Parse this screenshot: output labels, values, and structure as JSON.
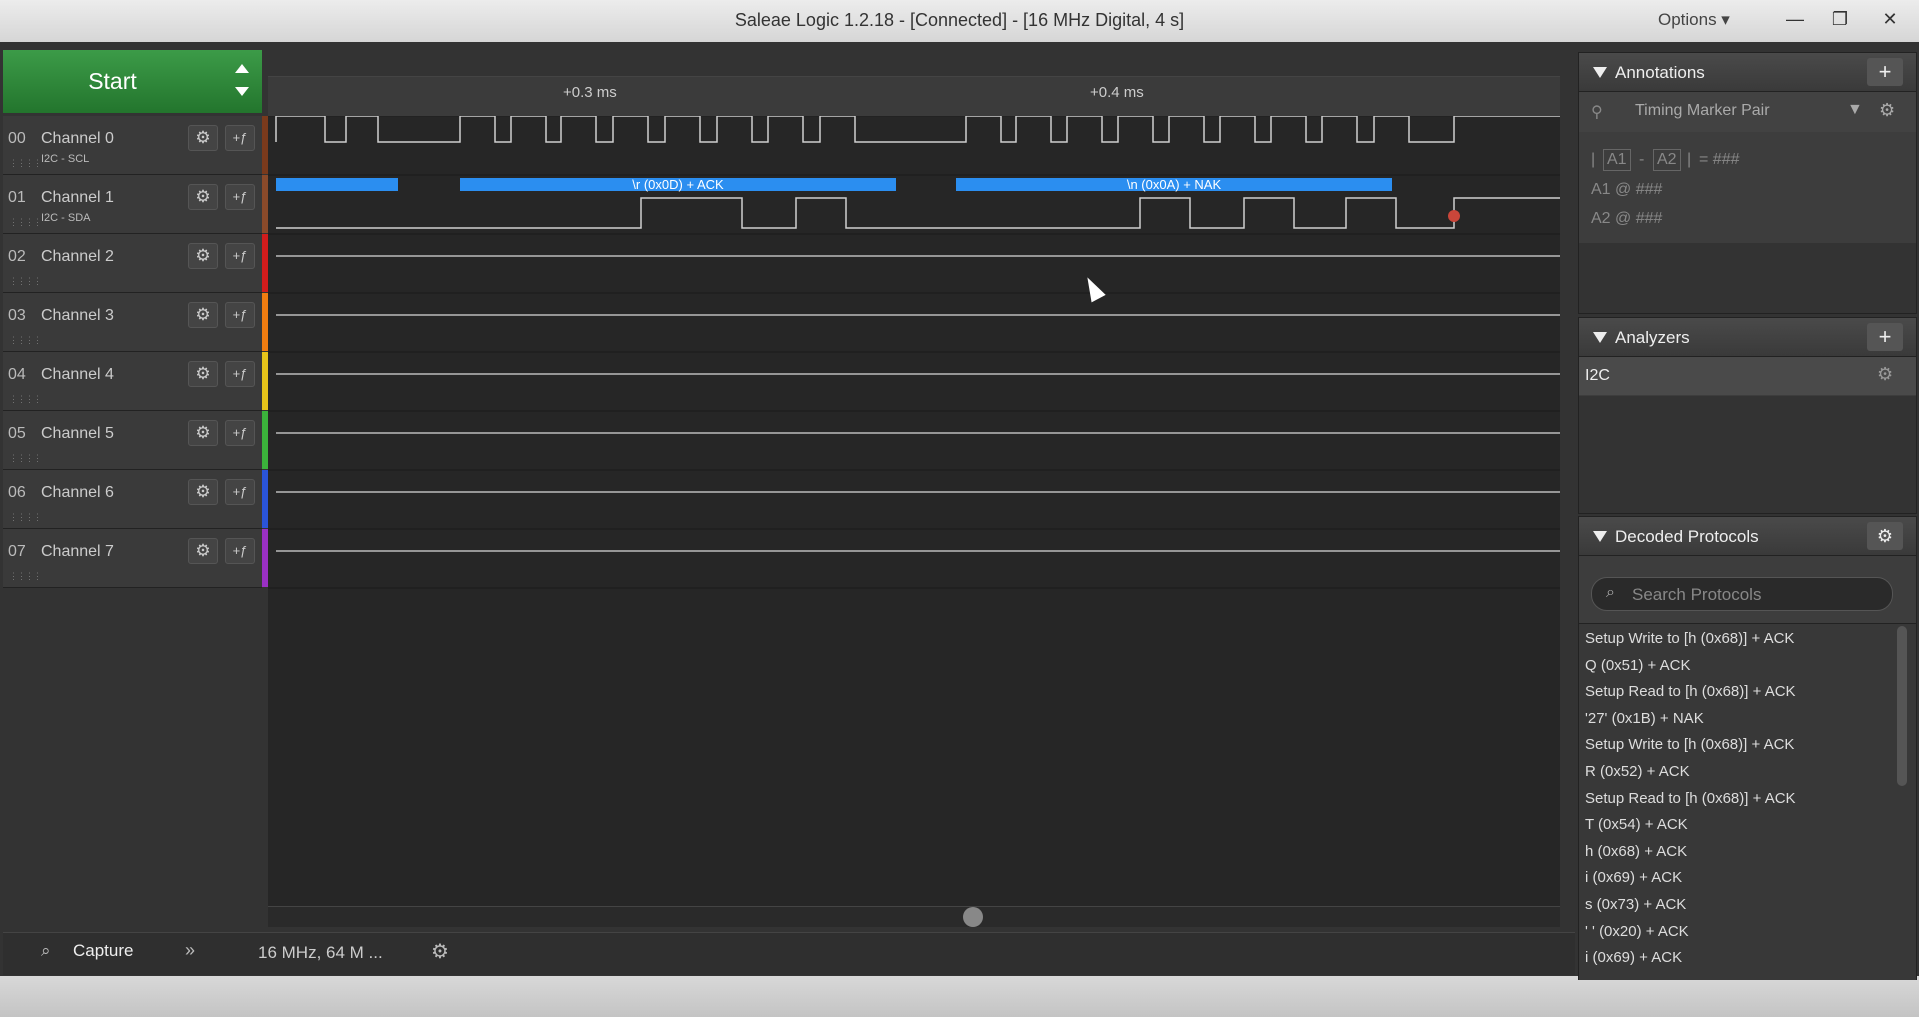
{
  "window": {
    "title": "Saleae Logic 1.2.18 - [Connected] - [16 MHz Digital, 4 s]",
    "options_label": "Options ▾",
    "minimize": "—",
    "restore": "❐",
    "close": "✕"
  },
  "start": {
    "label": "Start"
  },
  "channels": [
    {
      "num": "00",
      "name": "Channel 0",
      "sub": "I2C - SCL",
      "color": "#7a3a1c"
    },
    {
      "num": "01",
      "name": "Channel 1",
      "sub": "I2C - SDA",
      "color": "#8a4a2a"
    },
    {
      "num": "02",
      "name": "Channel 2",
      "sub": "",
      "color": "#d11c1c"
    },
    {
      "num": "03",
      "name": "Channel 3",
      "sub": "",
      "color": "#f07d11"
    },
    {
      "num": "04",
      "name": "Channel 4",
      "sub": "",
      "color": "#e7c41a"
    },
    {
      "num": "05",
      "name": "Channel 5",
      "sub": "",
      "color": "#3bb33b"
    },
    {
      "num": "06",
      "name": "Channel 6",
      "sub": "",
      "color": "#2a54d8"
    },
    {
      "num": "07",
      "name": "Channel 7",
      "sub": "",
      "color": "#9a30c4"
    }
  ],
  "timeline": {
    "tick1": "+0.3 ms",
    "tick2": "+0.4 ms"
  },
  "decode_bars": {
    "bar1": "\\r (0x0D) + ACK",
    "bar2": "\\n (0x0A) + NAK"
  },
  "annotations": {
    "title": "Annotations",
    "marker": "Timing Marker Pair",
    "formula": {
      "a1": "A1",
      "dash": "-",
      "a2": "A2",
      "eq": "= ###"
    },
    "row1": "A1  @  ###",
    "row2": "A2  @  ###"
  },
  "analyzers": {
    "title": "Analyzers",
    "item": "I2C"
  },
  "decoded": {
    "title": "Decoded Protocols",
    "search_placeholder": "Search Protocols",
    "items": [
      "Setup Write to [h (0x68)] + ACK",
      "Q (0x51) + ACK",
      "Setup Read to [h (0x68)] + ACK",
      "'27' (0x1B) + NAK",
      "Setup Write to [h (0x68)] + ACK",
      "R (0x52) + ACK",
      "Setup Read to [h (0x68)] + ACK",
      "T (0x54) + ACK",
      "h (0x68) + ACK",
      "i (0x69) + ACK",
      "s (0x73) + ACK",
      "' ' (0x20) + ACK",
      "i (0x69) + ACK"
    ]
  },
  "bottom": {
    "capture": "Capture",
    "rate": "16 MHz, 64 M ..."
  }
}
